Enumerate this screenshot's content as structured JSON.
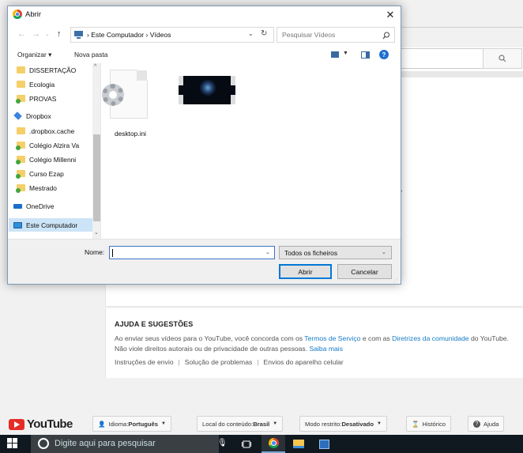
{
  "dialog": {
    "title": "Abrir",
    "breadcrumb": "›  Este Computador  ›  Vídeos",
    "search_placeholder": "Pesquisar Vídeos",
    "toolbar": {
      "organize": "Organizar ▾",
      "new_folder": "Nova pasta",
      "help": "?"
    },
    "nav_items": [
      {
        "label": "DISSERTAÇÃO",
        "icon": "folder-icon"
      },
      {
        "label": "Ecologia",
        "icon": "folder-icon"
      },
      {
        "label": "PROVAS",
        "icon": "folder-sync-icon"
      },
      {
        "label": "Dropbox",
        "icon": "dropbox-icon"
      },
      {
        "label": ".dropbox.cache",
        "icon": "folder-icon"
      },
      {
        "label": "Colégio Alzira Va",
        "icon": "folder-sync-icon"
      },
      {
        "label": "Colégio Millenni",
        "icon": "folder-sync-icon"
      },
      {
        "label": "Curso Ezap",
        "icon": "folder-sync-icon"
      },
      {
        "label": "Mestrado",
        "icon": "folder-sync-icon"
      },
      {
        "label": "OneDrive",
        "icon": "cloud-icon"
      },
      {
        "label": "Este Computador",
        "icon": "computer-icon",
        "selected": true
      }
    ],
    "files": [
      {
        "name": "desktop.ini",
        "icon": "settings-file-icon"
      },
      {
        "name": "",
        "icon": "video-thumbnail-icon"
      }
    ],
    "name_label": "Nome:",
    "name_value": "",
    "type_value": "Todos os ficheiros",
    "open_label": "Abrir",
    "cancel_label": "Cancelar",
    "close_glyph": "✕"
  },
  "help": {
    "title": "AJUDA E SUGESTÕES",
    "line1_a": "Ao enviar seus vídeos para o YouTube, você concorda com os ",
    "line1_link1": "Termos de Serviço",
    "line1_b": " e com as ",
    "line1_link2": "Diretrizes da comunidade",
    "line1_c": " do YouTube.",
    "line2_a": "Não viole direitos autorais ou de privacidade de outras pessoas. ",
    "line2_link": "Saiba mais",
    "links": [
      "Instruções de envio",
      "Solução de problemas",
      "Envios do aparelho celular"
    ]
  },
  "footer": {
    "logo": "YouTube",
    "language_label": "Idioma: ",
    "language_value": "Português",
    "location_label": "Local do conteúdo: ",
    "location_value": "Brasil",
    "restricted_label": "Modo restrito: ",
    "restricted_value": "Desativado",
    "history": "Histórico",
    "help": "Ajuda"
  },
  "taskbar": {
    "search_placeholder": "Digite aqui para pesquisar"
  },
  "colors": {
    "youtube_red": "#e52d27",
    "link_blue": "#167ac6",
    "selection": "#cce4f7",
    "taskbar": "#101820"
  }
}
